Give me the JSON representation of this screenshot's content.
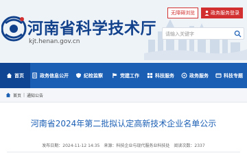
{
  "header": {
    "site_title": "河南省科学技术厅",
    "site_url": "kjt.henan.gov.cn",
    "accessibility_label": "无障碍浏览",
    "login_label": "政务服务登录",
    "search_placeholder": "请输入关键字",
    "colors": {
      "title": "#12418c",
      "accent": "#d23030"
    }
  },
  "nav": {
    "items": [
      {
        "label": "首页",
        "icon": "home-icon",
        "active": true
      },
      {
        "label": "政务信息公开",
        "icon": "document-icon"
      },
      {
        "label": "纪检监察",
        "icon": "shield-icon"
      },
      {
        "label": "党建工作",
        "icon": "flag-icon"
      },
      {
        "label": "科技服务",
        "icon": "grid-icon"
      },
      {
        "label": "政务服务",
        "icon": "service-icon"
      },
      {
        "label": "科技专题",
        "icon": "topic-icon"
      }
    ],
    "colors": {
      "background": "#1b5fb5",
      "active": "#0f4593"
    }
  },
  "breadcrumb": {
    "items": [
      "首页",
      "通知公告"
    ],
    "separator": "|"
  },
  "article": {
    "title": "河南省2024年第二批拟认定高新技术企业名单公示",
    "published_label": "发布日期：",
    "published_value": "2024-11-12 14:35",
    "source_label": "来源：",
    "source_value": "科技企业与现代服务业科技处",
    "views_label": "阅读次数：",
    "views_value": "2337"
  }
}
